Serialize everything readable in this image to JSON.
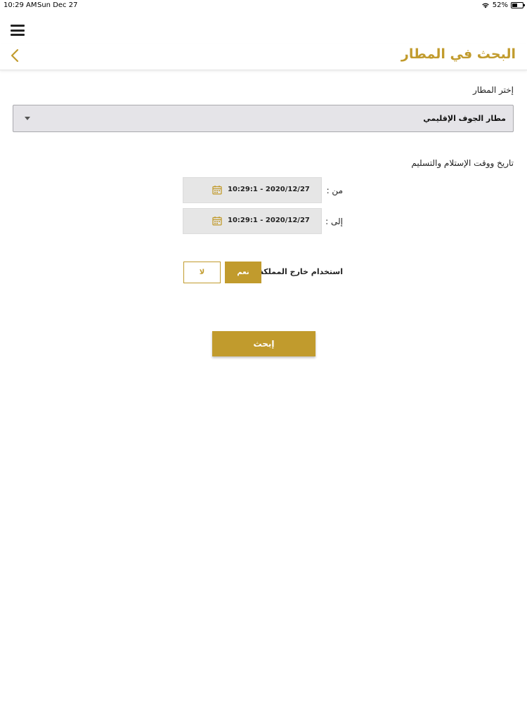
{
  "status_bar": {
    "time": "10:29 AM",
    "date": "Sun Dec 27",
    "battery": "52%",
    "battery_level": 0.52
  },
  "header": {
    "title": "البحث في المطار",
    "menu_icon": "hamburger-icon",
    "back_icon": "chevron-left-icon"
  },
  "airport": {
    "label": "إختر المطار",
    "selected": "مطار الجوف الإقليمي"
  },
  "datetime": {
    "label": "تاريخ ووقت الإستلام والتسليم",
    "from_label": "من :",
    "from_value": "10:29:1 - 2020/12/27",
    "to_label": "إلى :",
    "to_value": "10:29:1 - 2020/12/27"
  },
  "outside_kingdom": {
    "label": "استخدام خارج المملكة :",
    "yes": "نعم",
    "no": "لا",
    "selected": "yes"
  },
  "search_button": "إبحث",
  "colors": {
    "accent": "#c19b2d",
    "field_bg": "#e6e6e6"
  }
}
